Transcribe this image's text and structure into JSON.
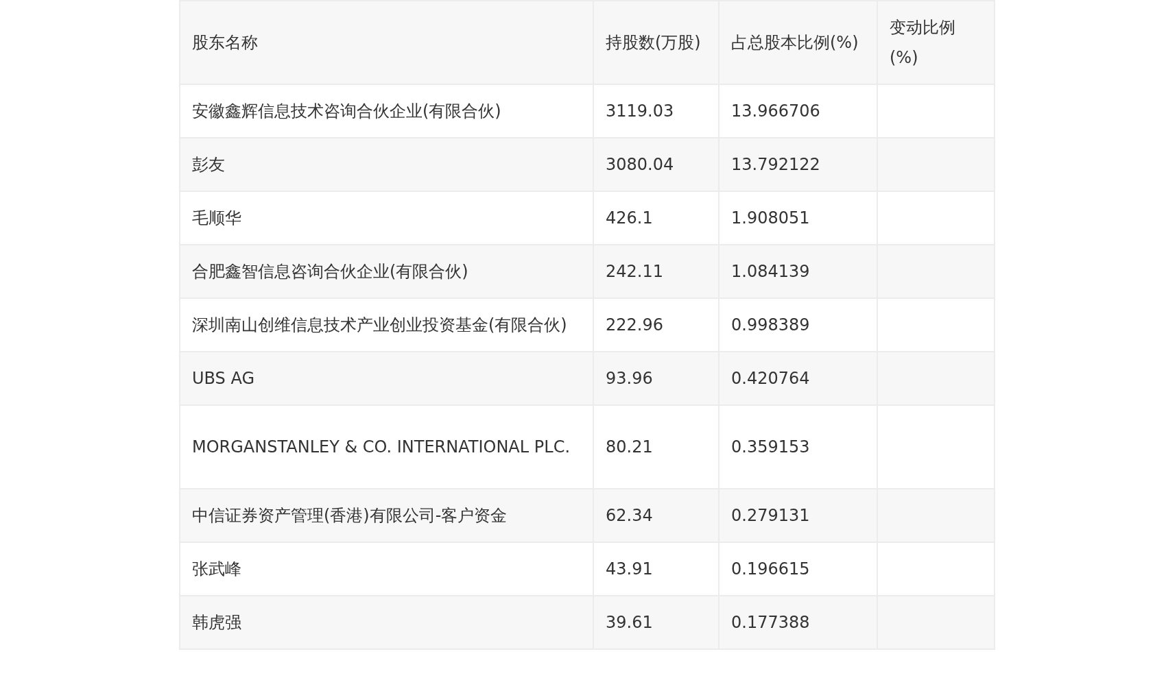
{
  "table": {
    "columns": [
      "股东名称",
      "持股数(万股)",
      "占总股本比例(%)",
      "变动比例(%)"
    ],
    "rows": [
      [
        "安徽鑫辉信息技术咨询合伙企业(有限合伙)",
        "3119.03",
        "13.966706",
        ""
      ],
      [
        "彭友",
        "3080.04",
        "13.792122",
        ""
      ],
      [
        "毛顺华",
        "426.1",
        "1.908051",
        ""
      ],
      [
        "合肥鑫智信息咨询合伙企业(有限合伙)",
        "242.11",
        "1.084139",
        ""
      ],
      [
        "深圳南山创维信息技术产业创业投资基金(有限合伙)",
        "222.96",
        "0.998389",
        ""
      ],
      [
        "UBS AG",
        "93.96",
        "0.420764",
        ""
      ],
      [
        "MORGANSTANLEY & CO. INTERNATIONAL PLC.",
        "80.21",
        "0.359153",
        ""
      ],
      [
        "中信证券资产管理(香港)有限公司-客户资金",
        "62.34",
        "0.279131",
        ""
      ],
      [
        "张武峰",
        "43.91",
        "0.196615",
        ""
      ],
      [
        "韩虎强",
        "39.61",
        "0.177388",
        ""
      ]
    ]
  }
}
